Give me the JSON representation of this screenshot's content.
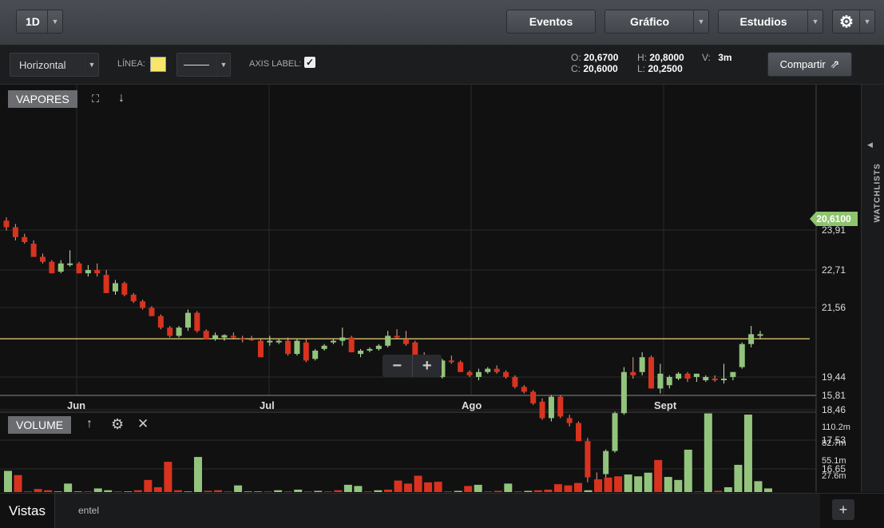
{
  "topbar": {
    "period": "1D",
    "events": "Eventos",
    "chart": "Gráfico",
    "studies": "Estudios"
  },
  "toolbar": {
    "draw_type": "Horizontal",
    "line_label": "LÍNEA:",
    "line_color": "#f7e66a",
    "axis_label": "AXIS LABEL:",
    "share": "Compartir",
    "ohlc": {
      "o_label": "O:",
      "o": "20,6700",
      "h_label": "H:",
      "h": "20,8000",
      "v_label": "V:",
      "v": "3m",
      "c_label": "C:",
      "c": "20,6000",
      "l_label": "L:",
      "l": "20,2500"
    }
  },
  "chart": {
    "panel_label": "VAPORES",
    "current_price": "20,6100",
    "y_ticks": [
      "23,91",
      "22,71",
      "21,56",
      "19,44",
      "18,46",
      "17,53",
      "16,65",
      "15,81"
    ],
    "x_ticks": [
      "Jun",
      "Jul",
      "Ago",
      "Sept"
    ]
  },
  "volume": {
    "panel_label": "VOLUME",
    "ticks": [
      "110.2m",
      "82.7m",
      "55.1m",
      "27.6m"
    ]
  },
  "sidebar": {
    "watchlists": "WATCHLISTS"
  },
  "bottom": {
    "views": "Vistas",
    "symbol": "entel"
  },
  "colors": {
    "up": "#93c47d",
    "down": "#d9331f",
    "price_line": "#c8b468"
  },
  "chart_data": {
    "type": "candlestick",
    "x_ticks": [
      "Jun",
      "Jul",
      "Ago",
      "Sept"
    ],
    "y_ticks": [
      23.91,
      22.71,
      21.56,
      19.44,
      18.46,
      17.53,
      16.65,
      15.81
    ],
    "horizontal_line": 20.61,
    "candles": [
      [
        24.2,
        24.3,
        23.9,
        24.0
      ],
      [
        24.0,
        24.1,
        23.6,
        23.7
      ],
      [
        23.7,
        23.8,
        23.5,
        23.55
      ],
      [
        23.5,
        23.6,
        23.1,
        23.1
      ],
      [
        23.1,
        23.2,
        22.9,
        22.95
      ],
      [
        22.95,
        23.0,
        22.6,
        22.6
      ],
      [
        22.65,
        23.0,
        22.6,
        22.9
      ],
      [
        22.85,
        23.3,
        22.8,
        22.9
      ],
      [
        22.9,
        22.95,
        22.6,
        22.6
      ],
      [
        22.6,
        22.85,
        22.5,
        22.7
      ],
      [
        22.7,
        22.9,
        22.5,
        22.6
      ],
      [
        22.55,
        22.7,
        22.0,
        22.0
      ],
      [
        22.05,
        22.4,
        21.95,
        22.3
      ],
      [
        22.3,
        22.35,
        21.9,
        21.95
      ],
      [
        21.95,
        22.0,
        21.7,
        21.75
      ],
      [
        21.75,
        21.8,
        21.5,
        21.55
      ],
      [
        21.55,
        21.6,
        21.3,
        21.3
      ],
      [
        21.3,
        21.35,
        20.9,
        20.95
      ],
      [
        20.95,
        21.0,
        20.65,
        20.7
      ],
      [
        20.7,
        21.0,
        20.65,
        20.95
      ],
      [
        20.95,
        21.5,
        20.85,
        21.4
      ],
      [
        21.4,
        21.45,
        20.8,
        20.85
      ],
      [
        20.85,
        20.9,
        20.6,
        20.6
      ],
      [
        20.6,
        20.8,
        20.55,
        20.72
      ],
      [
        20.65,
        20.75,
        20.55,
        20.72
      ],
      [
        20.7,
        20.8,
        20.6,
        20.65
      ],
      [
        20.62,
        20.7,
        20.5,
        20.6
      ],
      [
        20.6,
        20.7,
        20.55,
        20.58
      ],
      [
        20.55,
        20.6,
        20.05,
        20.05
      ],
      [
        20.5,
        20.7,
        20.4,
        20.55
      ],
      [
        20.5,
        20.6,
        20.45,
        20.55
      ],
      [
        20.55,
        20.65,
        20.1,
        20.15
      ],
      [
        20.15,
        20.6,
        20.1,
        20.55
      ],
      [
        20.5,
        20.6,
        19.9,
        19.95
      ],
      [
        20.0,
        20.3,
        19.95,
        20.25
      ],
      [
        20.3,
        20.45,
        20.25,
        20.4
      ],
      [
        20.5,
        20.6,
        20.45,
        20.55
      ],
      [
        20.55,
        20.95,
        20.4,
        20.65
      ],
      [
        20.65,
        20.7,
        20.2,
        20.2
      ],
      [
        20.15,
        20.3,
        20.05,
        20.25
      ],
      [
        20.25,
        20.35,
        20.2,
        20.3
      ],
      [
        20.3,
        20.45,
        20.25,
        20.4
      ],
      [
        20.4,
        20.85,
        20.35,
        20.7
      ],
      [
        20.7,
        20.9,
        20.6,
        20.65
      ],
      [
        20.6,
        20.85,
        20.4,
        20.45
      ],
      [
        20.5,
        20.55,
        20.05,
        20.1
      ],
      [
        20.1,
        20.2,
        19.95,
        20.0
      ],
      [
        19.95,
        20.0,
        19.45,
        19.45
      ],
      [
        19.45,
        20.0,
        19.4,
        19.95
      ],
      [
        19.95,
        20.1,
        19.85,
        19.9
      ],
      [
        19.9,
        19.95,
        19.6,
        19.6
      ],
      [
        19.6,
        19.65,
        19.45,
        19.5
      ],
      [
        19.45,
        19.7,
        19.35,
        19.6
      ],
      [
        19.6,
        19.75,
        19.55,
        19.7
      ],
      [
        19.7,
        19.8,
        19.55,
        19.6
      ],
      [
        19.6,
        19.65,
        19.4,
        19.45
      ],
      [
        19.45,
        19.5,
        19.1,
        19.15
      ],
      [
        19.15,
        19.2,
        18.95,
        19.0
      ],
      [
        19.0,
        19.05,
        18.6,
        18.65
      ],
      [
        18.7,
        18.8,
        18.15,
        18.2
      ],
      [
        18.2,
        18.9,
        18.1,
        18.85
      ],
      [
        18.85,
        18.9,
        18.2,
        18.25
      ],
      [
        18.2,
        18.3,
        17.95,
        18.05
      ],
      [
        18.05,
        18.1,
        17.5,
        17.5
      ],
      [
        17.5,
        17.6,
        16.25,
        16.4
      ],
      [
        16.3,
        16.55,
        16.1,
        16.25
      ],
      [
        16.5,
        17.25,
        16.4,
        17.2
      ],
      [
        17.2,
        18.4,
        17.15,
        18.35
      ],
      [
        18.35,
        19.75,
        18.3,
        19.6
      ],
      [
        19.6,
        20.05,
        19.4,
        19.5
      ],
      [
        19.6,
        20.2,
        19.5,
        20.05
      ],
      [
        20.05,
        20.1,
        19.1,
        19.1
      ],
      [
        19.1,
        19.85,
        18.95,
        19.55
      ],
      [
        19.2,
        19.5,
        19.1,
        19.45
      ],
      [
        19.4,
        19.6,
        19.35,
        19.55
      ],
      [
        19.55,
        19.6,
        19.3,
        19.4
      ],
      [
        19.45,
        19.55,
        19.3,
        19.55
      ],
      [
        19.35,
        19.5,
        19.3,
        19.45
      ],
      [
        19.4,
        19.5,
        19.3,
        19.35
      ],
      [
        19.35,
        19.85,
        19.25,
        19.4
      ],
      [
        19.45,
        19.6,
        19.35,
        19.6
      ],
      [
        19.75,
        20.5,
        19.7,
        20.45
      ],
      [
        20.45,
        21.0,
        20.35,
        20.75
      ],
      [
        20.7,
        20.85,
        20.6,
        20.75
      ]
    ],
    "volume_unit": "m",
    "volumes": [
      [
        35,
        1
      ],
      [
        28,
        0
      ],
      [
        1,
        0
      ],
      [
        5,
        0
      ],
      [
        3,
        0
      ],
      [
        1,
        1
      ],
      [
        14,
        1
      ],
      [
        1,
        1
      ],
      [
        1,
        0
      ],
      [
        6,
        1
      ],
      [
        3,
        1
      ],
      [
        1,
        0
      ],
      [
        1,
        1
      ],
      [
        3,
        0
      ],
      [
        20,
        0
      ],
      [
        8,
        0
      ],
      [
        50,
        0
      ],
      [
        3,
        0
      ],
      [
        1,
        1
      ],
      [
        58,
        1
      ],
      [
        2,
        0
      ],
      [
        3,
        0
      ],
      [
        1,
        0
      ],
      [
        11,
        1
      ],
      [
        1,
        1
      ],
      [
        1,
        1
      ],
      [
        1,
        0
      ],
      [
        3,
        1
      ],
      [
        1,
        0
      ],
      [
        4,
        1
      ],
      [
        1,
        0
      ],
      [
        2,
        1
      ],
      [
        1,
        0
      ],
      [
        3,
        0
      ],
      [
        12,
        1
      ],
      [
        10,
        1
      ],
      [
        1,
        0
      ],
      [
        3,
        1
      ],
      [
        4,
        0
      ],
      [
        19,
        0
      ],
      [
        14,
        0
      ],
      [
        27,
        0
      ],
      [
        16,
        0
      ],
      [
        17,
        0
      ],
      [
        1,
        0
      ],
      [
        2,
        1
      ],
      [
        10,
        0
      ],
      [
        12,
        1
      ],
      [
        1,
        0
      ],
      [
        2,
        0
      ],
      [
        14,
        1
      ],
      [
        1,
        0
      ],
      [
        2,
        1
      ],
      [
        3,
        0
      ],
      [
        4,
        0
      ],
      [
        13,
        0
      ],
      [
        11,
        0
      ],
      [
        15,
        0
      ],
      [
        3,
        1
      ],
      [
        21,
        0
      ],
      [
        24,
        0
      ],
      [
        26,
        0
      ],
      [
        29,
        1
      ],
      [
        26,
        1
      ],
      [
        32,
        1
      ],
      [
        53,
        0
      ],
      [
        25,
        1
      ],
      [
        20,
        1
      ],
      [
        70,
        1
      ],
      [
        1,
        0
      ],
      [
        130,
        1
      ],
      [
        2,
        0
      ],
      [
        8,
        1
      ],
      [
        45,
        1
      ],
      [
        128,
        1
      ],
      [
        18,
        1
      ],
      [
        6,
        1
      ]
    ]
  }
}
